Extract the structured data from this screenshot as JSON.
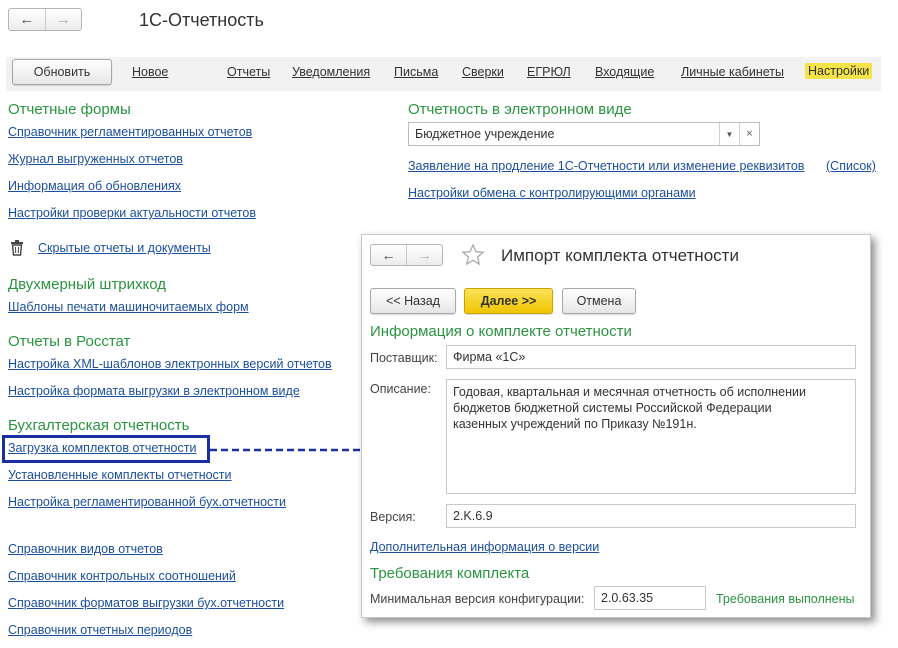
{
  "app": {
    "title": "1С-Отчетность"
  },
  "toolbar": {
    "refresh": "Обновить",
    "items": [
      "Новое",
      "Отчеты",
      "Уведомления",
      "Письма",
      "Сверки",
      "ЕГРЮЛ",
      "Входящие",
      "Личные кабинеты",
      "Настройки"
    ],
    "active_item": "Настройки"
  },
  "left": {
    "sections": [
      {
        "title": "Отчетные формы",
        "links": [
          "Справочник регламентированных отчетов",
          "Журнал выгруженных отчетов",
          "Информация об обновлениях",
          "Настройки проверки актуальности отчетов"
        ]
      },
      {
        "hidden_link": "Скрытые отчеты и документы"
      },
      {
        "title": "Двухмерный штрихкод",
        "links": [
          "Шаблоны печати машиночитаемых форм"
        ]
      },
      {
        "title": "Отчеты в Росстат",
        "links": [
          "Настройка XML-шаблонов электронных версий отчетов",
          "Настройка формата выгрузки в электронном виде"
        ]
      },
      {
        "title": "Бухгалтерская отчетность",
        "links": [
          "Загрузка комплектов отчетности",
          "Установленные комплекты отчетности",
          "Настройка регламентированной бух.отчетности"
        ]
      },
      {
        "links": [
          "Справочник видов отчетов",
          "Справочник контрольных соотношений",
          "Справочник форматов выгрузки бух.отчетности",
          "Справочник отчетных периодов"
        ]
      }
    ]
  },
  "right": {
    "title": "Отчетность в электронном виде",
    "combo_value": "Бюджетное учреждение",
    "link_renew": "Заявление на продление 1С-Отчетности или изменение реквизитов",
    "link_list": "(Список)",
    "link_exchange": "Настройки обмена с контролирующими органами"
  },
  "dialog": {
    "title": "Импорт комплекта отчетности",
    "back": "<< Назад",
    "next": "Далее >>",
    "cancel": "Отмена",
    "info_title": "Информация о комплекте отчетности",
    "supplier_label": "Поставщик:",
    "supplier_value": "Фирма «1С»",
    "desc_label": "Описание:",
    "desc_value": "Годовая, квартальная и месячная отчетность об исполнении\nбюджетов бюджетной системы Российской Федерации\nказенных учреждений по Приказу №191н.",
    "version_label": "Версия:",
    "version_value": "2.K.6.9",
    "more_info_link": "Дополнительная информация о версии",
    "req_title": "Требования комплекта",
    "min_config_label": "Минимальная версия конфигурации:",
    "min_config_value": "2.0.63.35",
    "req_status": "Требования выполнены"
  },
  "colors": {
    "accent_green": "#2a9440",
    "link_blue": "#1c4f9c",
    "highlight": "#1a2fa0",
    "active_tab": "#f5e34a"
  },
  "icons": [
    "arrow-left-icon",
    "arrow-right-icon",
    "trash-icon",
    "star-icon"
  ]
}
